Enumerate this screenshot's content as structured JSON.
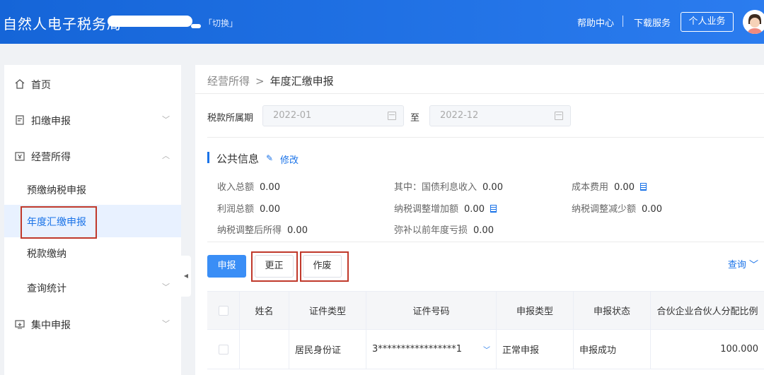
{
  "header": {
    "title": "自然人电子税务局",
    "switch_label": "「切换」",
    "help_label": "帮助中心",
    "download_label": "下载服务",
    "personal_label": "个人业务"
  },
  "sidebar": {
    "items": [
      {
        "label": "首页"
      },
      {
        "label": "扣缴申报"
      },
      {
        "label": "经营所得"
      },
      {
        "label": "预缴纳税申报"
      },
      {
        "label": "年度汇缴申报"
      },
      {
        "label": "税款缴纳"
      },
      {
        "label": "查询统计"
      },
      {
        "label": "集中申报"
      }
    ]
  },
  "breadcrumb": {
    "parent": "经营所得",
    "separator": ">",
    "current": "年度汇缴申报"
  },
  "period": {
    "label": "税款所属期",
    "from": "2022-01",
    "to_label": "至",
    "to": "2022-12"
  },
  "public_info": {
    "title": "公共信息",
    "edit_label": "修改",
    "fields": [
      {
        "label": "收入总额",
        "value": "0.00"
      },
      {
        "label": "其中：国债利息收入",
        "value": "0.00"
      },
      {
        "label": "成本费用",
        "value": "0.00"
      },
      {
        "label": "利润总额",
        "value": "0.00"
      },
      {
        "label": "纳税调整增加额",
        "value": "0.00"
      },
      {
        "label": "纳税调整减少额",
        "value": "0.00"
      },
      {
        "label": "纳税调整后所得",
        "value": "0.00"
      },
      {
        "label": "弥补以前年度亏损",
        "value": "0.00"
      }
    ]
  },
  "actions": {
    "declare": "申报",
    "correct": "更正",
    "void": "作废",
    "query": "查询"
  },
  "table": {
    "headers": [
      "姓名",
      "证件类型",
      "证件号码",
      "申报类型",
      "申报状态",
      "合伙企业合伙人分配比例"
    ],
    "rows": [
      {
        "name": "",
        "id_type": "居民身份证",
        "id_number": "3*****************1",
        "decl_type": "正常申报",
        "status": "申报成功",
        "ratio": "100.000"
      }
    ]
  },
  "colors": {
    "header_bg": "#1a73e8",
    "accent": "#1a73e8",
    "highlight_box": "#c0392b"
  }
}
